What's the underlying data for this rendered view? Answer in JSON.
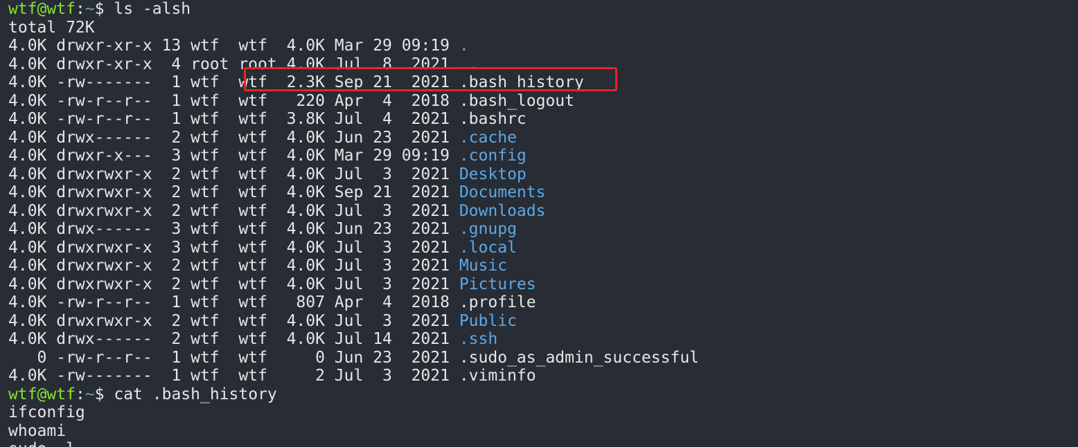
{
  "prompt": {
    "user_host": "wtf@wtf",
    "separator": ":",
    "path": "~",
    "symbol": "$ "
  },
  "commands": {
    "ls": "ls -alsh",
    "cat": "cat .bash_history"
  },
  "ls_output": {
    "total": "total 72K",
    "rows": [
      {
        "meta": "4.0K drwxr-xr-x 13 wtf  wtf  4.0K Mar 29 09:19 ",
        "name": ".",
        "is_dir": true
      },
      {
        "meta": "4.0K drwxr-xr-x  4 root root 4.0K Jul  8  2021 ",
        "name": "..",
        "is_dir": true
      },
      {
        "meta": "4.0K -rw-------  1 wtf  wtf  2.3K Sep 21  2021 ",
        "name": ".bash_history",
        "is_dir": false
      },
      {
        "meta": "4.0K -rw-r--r--  1 wtf  wtf   220 Apr  4  2018 ",
        "name": ".bash_logout",
        "is_dir": false
      },
      {
        "meta": "4.0K -rw-r--r--  1 wtf  wtf  3.8K Jul  4  2021 ",
        "name": ".bashrc",
        "is_dir": false
      },
      {
        "meta": "4.0K drwx------  2 wtf  wtf  4.0K Jun 23  2021 ",
        "name": ".cache",
        "is_dir": true
      },
      {
        "meta": "4.0K drwxr-x---  3 wtf  wtf  4.0K Mar 29 09:19 ",
        "name": ".config",
        "is_dir": true
      },
      {
        "meta": "4.0K drwxrwxr-x  2 wtf  wtf  4.0K Jul  3  2021 ",
        "name": "Desktop",
        "is_dir": true
      },
      {
        "meta": "4.0K drwxrwxr-x  2 wtf  wtf  4.0K Sep 21  2021 ",
        "name": "Documents",
        "is_dir": true
      },
      {
        "meta": "4.0K drwxrwxr-x  2 wtf  wtf  4.0K Jul  3  2021 ",
        "name": "Downloads",
        "is_dir": true
      },
      {
        "meta": "4.0K drwx------  3 wtf  wtf  4.0K Jun 23  2021 ",
        "name": ".gnupg",
        "is_dir": true
      },
      {
        "meta": "4.0K drwxrwxr-x  3 wtf  wtf  4.0K Jul  3  2021 ",
        "name": ".local",
        "is_dir": true
      },
      {
        "meta": "4.0K drwxrwxr-x  2 wtf  wtf  4.0K Jul  3  2021 ",
        "name": "Music",
        "is_dir": true
      },
      {
        "meta": "4.0K drwxrwxr-x  2 wtf  wtf  4.0K Jul  3  2021 ",
        "name": "Pictures",
        "is_dir": true
      },
      {
        "meta": "4.0K -rw-r--r--  1 wtf  wtf   807 Apr  4  2018 ",
        "name": ".profile",
        "is_dir": false
      },
      {
        "meta": "4.0K drwxrwxr-x  2 wtf  wtf  4.0K Jul  3  2021 ",
        "name": "Public",
        "is_dir": true
      },
      {
        "meta": "4.0K drwx------  2 wtf  wtf  4.0K Jul 14  2021 ",
        "name": ".ssh",
        "is_dir": true
      },
      {
        "meta": "   0 -rw-r--r--  1 wtf  wtf     0 Jun 23  2021 ",
        "name": ".sudo_as_admin_successful",
        "is_dir": false
      },
      {
        "meta": "4.0K -rw-------  1 wtf  wtf     2 Jul  3  2021 ",
        "name": ".viminfo",
        "is_dir": false
      }
    ]
  },
  "history_output": [
    "ifconfig",
    "whoami",
    "sudo -l"
  ],
  "colors": {
    "background": "#282c34",
    "text": "#e6e6e6",
    "prompt_user": "#8ae234",
    "prompt_path": "#729fcf",
    "directory": "#5ca8e6",
    "highlight_border": "#e8242b"
  }
}
